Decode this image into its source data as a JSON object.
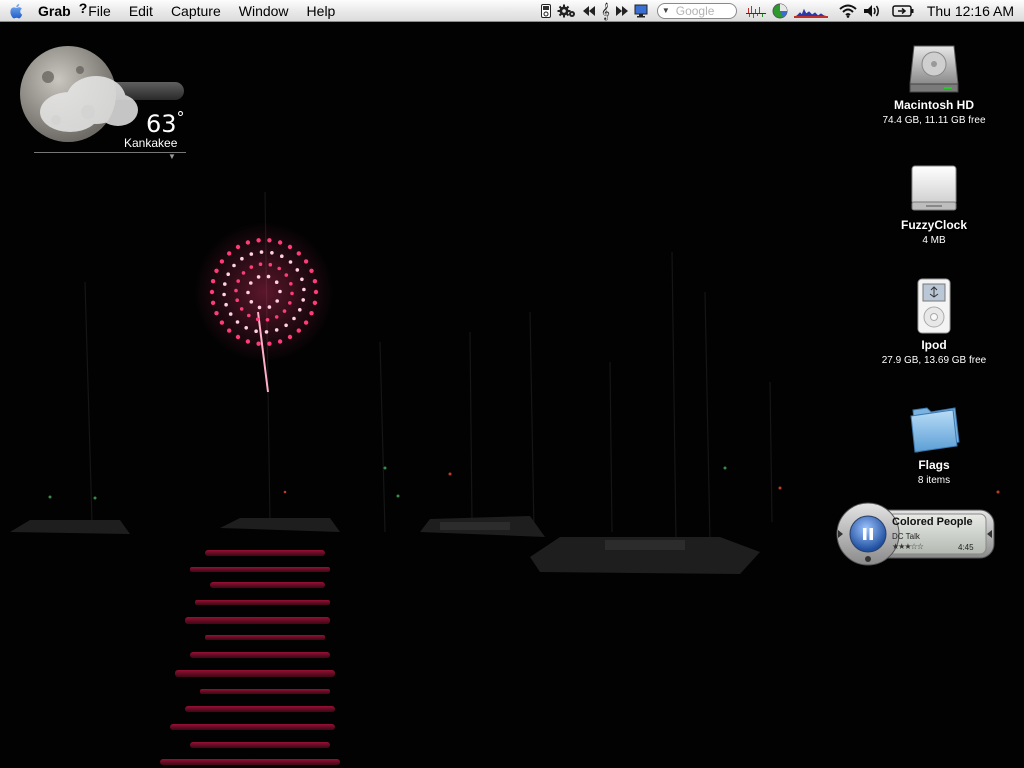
{
  "menubar": {
    "app_name": "Grab",
    "menus": [
      "File",
      "Edit",
      "Capture",
      "Window",
      "Help"
    ],
    "help_glyph": "?",
    "search_placeholder": "Google",
    "clock": "Thu 12:16 AM"
  },
  "weather": {
    "temperature": "63",
    "degree_symbol": "°",
    "city": "Kankakee"
  },
  "desktop_icons": [
    {
      "name": "Macintosh HD",
      "info": "74.4 GB, 11.11 GB free",
      "icon": "hard-drive-icon"
    },
    {
      "name": "FuzzyClock",
      "info": "4 MB",
      "icon": "disk-image-icon"
    },
    {
      "name": "Ipod",
      "info": "27.9 GB, 13.69 GB free",
      "icon": "ipod-icon"
    },
    {
      "name": "Flags",
      "info": "8 items",
      "icon": "folder-icon"
    }
  ],
  "itunes": {
    "song": "Colored People",
    "artist": "DC Talk",
    "rating_stars": "★★★☆☆",
    "time": "4:45"
  },
  "colors": {
    "menubar": "#e9e9e9",
    "firework": "#ff2d6d",
    "water_reflection": "#c8143c",
    "desktop_bg": "#020202"
  }
}
